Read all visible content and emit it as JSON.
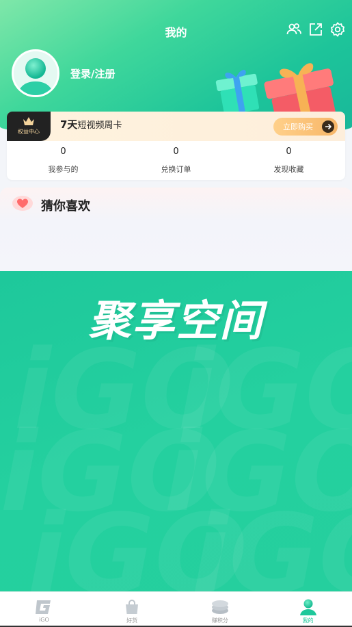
{
  "header": {
    "title": "我的",
    "login_text": "登录/注册"
  },
  "card": {
    "badge_label": "权益中心",
    "title_days": "7天",
    "title_rest": "短视频周卡",
    "buy_label": "立即购买",
    "stats": [
      {
        "value": "0",
        "label": "我参与的"
      },
      {
        "value": "0",
        "label": "兑换订单"
      },
      {
        "value": "0",
        "label": "发现收藏"
      }
    ]
  },
  "guess": {
    "title": "猜你喜欢"
  },
  "banner": {
    "title": "聚享空间"
  },
  "tabs": [
    {
      "label": "iGO",
      "icon": "igo-logo-icon"
    },
    {
      "label": "好货",
      "icon": "shopping-bag-icon"
    },
    {
      "label": "赚积分",
      "icon": "coins-icon"
    },
    {
      "label": "我的",
      "icon": "user-icon",
      "active": true
    }
  ],
  "colors": {
    "accent": "#1ec89b",
    "gold": "#f7b668"
  }
}
